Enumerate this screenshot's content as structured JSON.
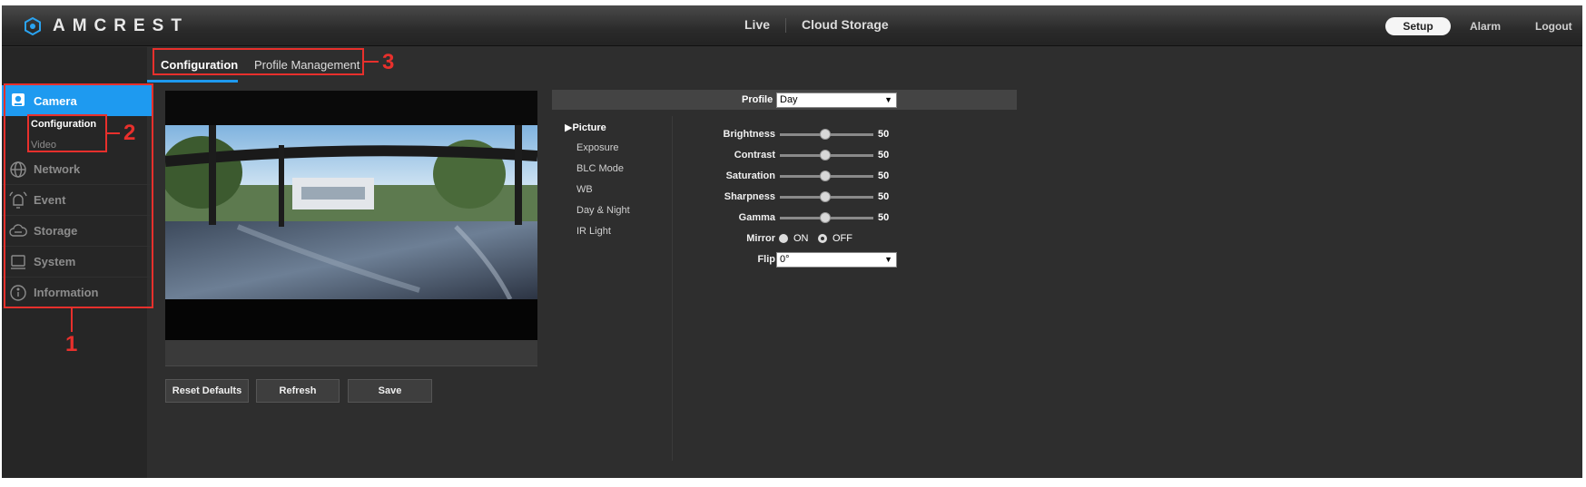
{
  "header": {
    "logo_text": "AMCREST",
    "nav": {
      "live": "Live",
      "cloud": "Cloud Storage"
    },
    "setup": "Setup",
    "alarm": "Alarm",
    "logout": "Logout"
  },
  "sidebar": {
    "items": [
      {
        "label": "Camera",
        "icon": "camera-icon"
      },
      {
        "label": "Network",
        "icon": "globe-icon"
      },
      {
        "label": "Event",
        "icon": "bell-icon"
      },
      {
        "label": "Storage",
        "icon": "cloud-icon"
      },
      {
        "label": "System",
        "icon": "monitor-icon"
      },
      {
        "label": "Information",
        "icon": "info-icon"
      }
    ],
    "subitems": {
      "configuration": "Configuration",
      "video": "Video"
    }
  },
  "tabs": {
    "configuration": "Configuration",
    "profile": "Profile Management"
  },
  "annotations": {
    "one": "1",
    "two": "2",
    "three": "3"
  },
  "video": {
    "timestamp": ""
  },
  "buttons": {
    "reset": "Reset Defaults",
    "refresh": "Refresh",
    "save": "Save"
  },
  "settings": {
    "profile_label": "Profile",
    "profile_value": "Day",
    "menu": [
      "Picture",
      "Exposure",
      "BLC Mode",
      "WB",
      "Day & Night",
      "IR Light"
    ],
    "sliders": [
      {
        "label": "Brightness",
        "value": "50"
      },
      {
        "label": "Contrast",
        "value": "50"
      },
      {
        "label": "Saturation",
        "value": "50"
      },
      {
        "label": "Sharpness",
        "value": "50"
      },
      {
        "label": "Gamma",
        "value": "50"
      }
    ],
    "mirror": {
      "label": "Mirror",
      "on": "ON",
      "off": "OFF",
      "selected": "OFF"
    },
    "flip": {
      "label": "Flip",
      "value": "0°"
    }
  },
  "colors": {
    "accent": "#1e9af0",
    "annotation": "#e8302c",
    "panel": "#2e2e2e"
  }
}
